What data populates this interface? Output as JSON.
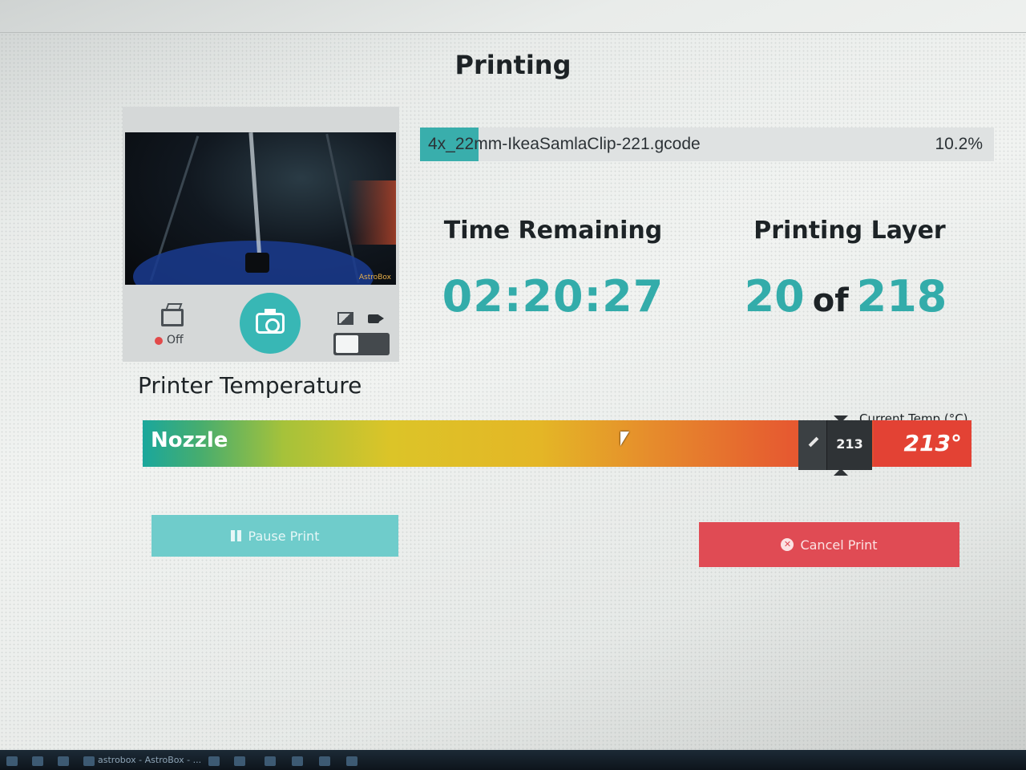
{
  "page": {
    "title": "Printing"
  },
  "camera": {
    "watermark": "AstroBox",
    "timelapse_status": "Off",
    "mode_toggle": "photo",
    "icons": {
      "timelapse": "timelapse-icon",
      "snapshot": "camera-icon",
      "photo": "image-icon",
      "video": "video-icon"
    }
  },
  "job": {
    "file_name": "4x_22mm-IkeaSamlaClip-221.gcode",
    "progress_percent": 10.2,
    "progress_label": "10.2%"
  },
  "stats": {
    "time_remaining_title": "Time Remaining",
    "time_remaining_value": "02:20:27",
    "printing_layer_title": "Printing Layer",
    "current_layer": "20",
    "layer_of": "of",
    "total_layers": "218"
  },
  "temperature": {
    "heading": "Printer Temperature",
    "current_temp_label": "Current Temp (°C)",
    "tool_name": "Nozzle",
    "target_value": "213",
    "current_value": "213°",
    "edit_icon": "pencil-icon"
  },
  "actions": {
    "pause_label": "Pause Print",
    "cancel_label": "Cancel Print",
    "pause_icon": "pause-icon",
    "cancel_icon": "x-circle-icon"
  },
  "colors": {
    "accent": "#38b7b5",
    "danger": "#e04b54",
    "pause_button": "#6fcccb",
    "temp_current": "#e34234"
  },
  "taskbar": {
    "active_window": "astrobox - AstroBox - ..."
  }
}
